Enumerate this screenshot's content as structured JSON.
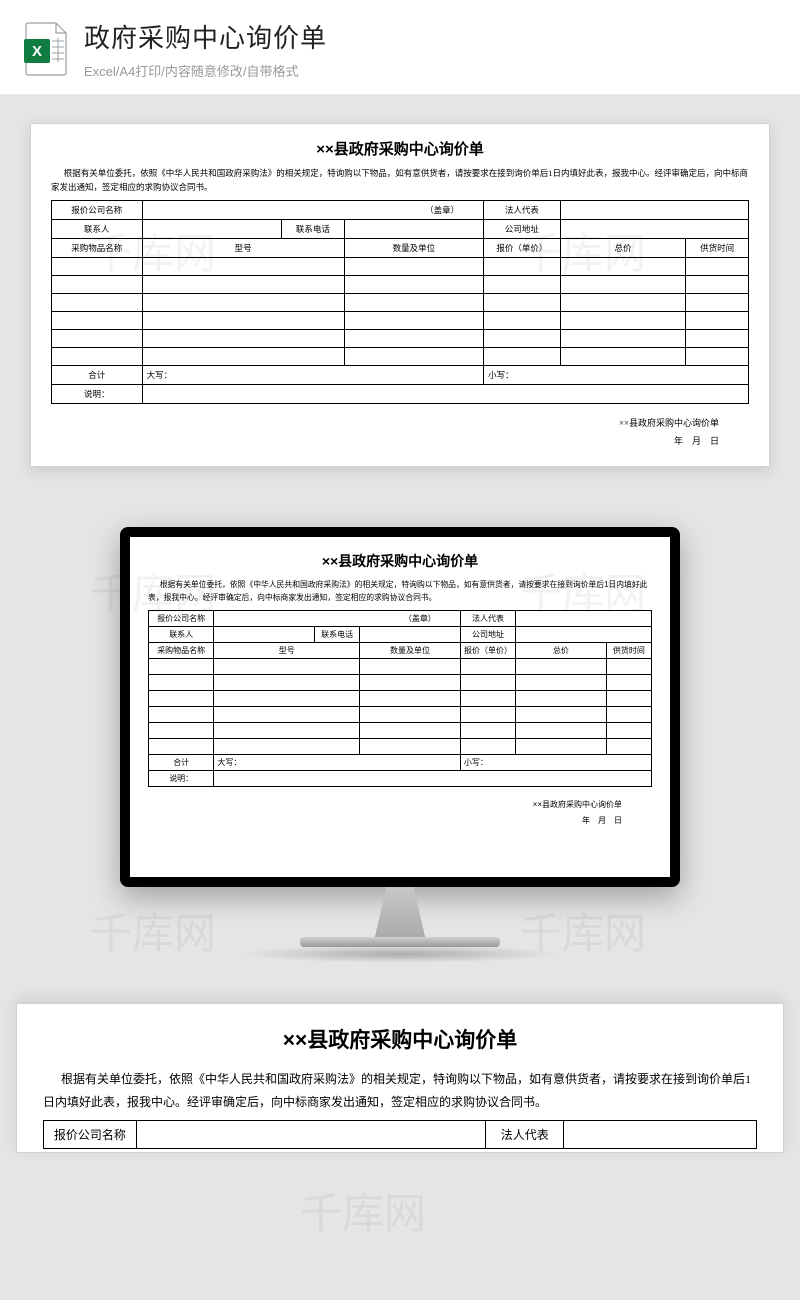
{
  "header": {
    "title": "政府采购中心询价单",
    "subtitle": "Excel/A4打印/内容随意修改/自带格式"
  },
  "watermark": "千库网",
  "doc": {
    "title": "××县政府采购中心询价单",
    "desc": "根据有关单位委托，依照《中华人民共和国政府采购法》的相关规定，特询购以下物品，如有意供货者，请按要求在接到询价单后1日内填好此表，报我中心。经评审确定后，向中标商家发出通知，签定相应的求购协议合同书。",
    "labels": {
      "company": "报价公司名称",
      "seal": "（盖章）",
      "legal": "法人代表",
      "contact": "联系人",
      "phone": "联系电话",
      "address": "公司地址",
      "item": "采购物品名称",
      "model": "型号",
      "qty": "数量及单位",
      "price": "报价（单价）",
      "total": "总价",
      "delivery": "供货时间",
      "sum": "合计",
      "upper": "大写：",
      "lower": "小写：",
      "note": "说明："
    },
    "footer1": "××县政府采购中心询价单",
    "footer2": "年　月　日"
  }
}
